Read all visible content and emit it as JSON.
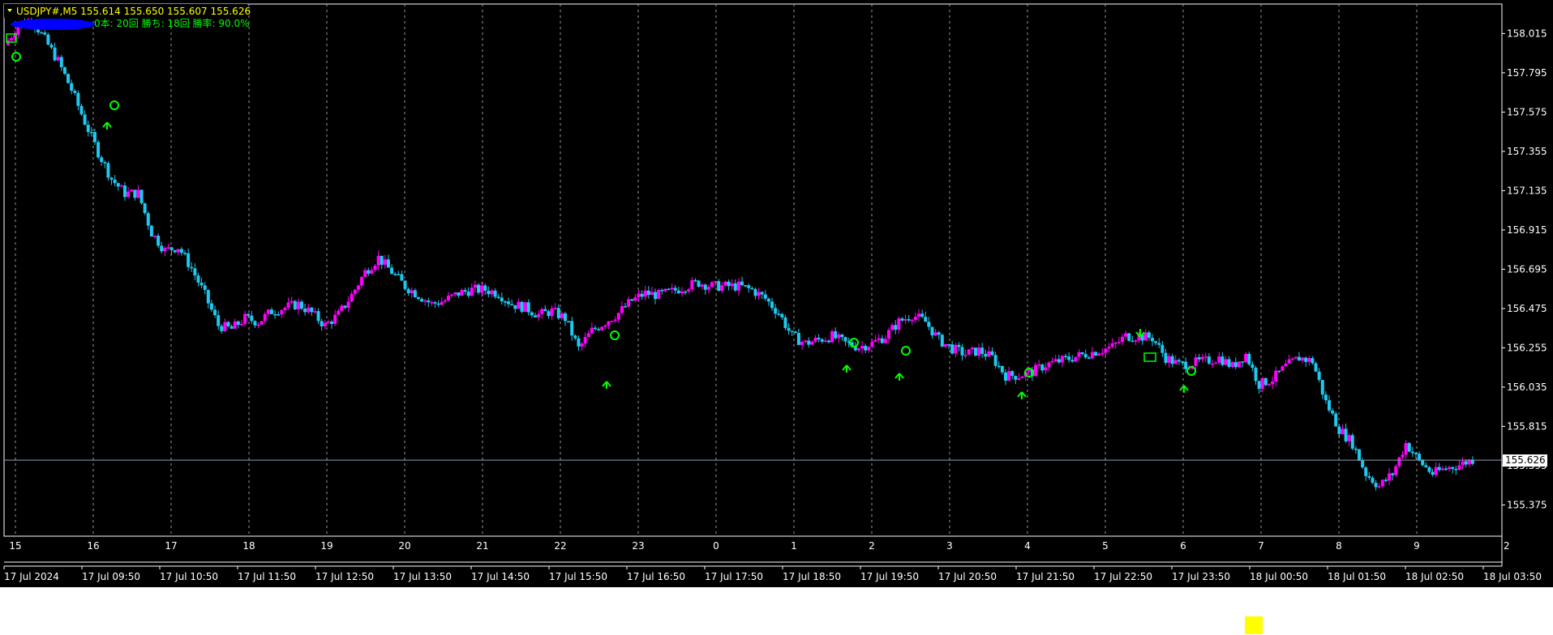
{
  "header": {
    "symbol_line": "USDJPY#,M5  155.614 155.650 155.607 155.626",
    "stats_visible": "0本: 20回    勝ち: 18回    勝率: 90.0%",
    "masked_prefix_note": ""
  },
  "colors": {
    "background": "#000000",
    "frame": "#ffffff",
    "grid": "#9a9a9a",
    "bull": "#ff00ff",
    "bear": "#1ec8f0",
    "signal": "#00ff00",
    "text": "#ffffff",
    "header_text": "#ffff00",
    "highlight": "#ffff00",
    "scribble": "#0000ff"
  },
  "chart_data": {
    "type": "candlestick",
    "symbol": "USDJPY#",
    "timeframe": "M5",
    "ohlc_current": {
      "open": 155.614,
      "high": 155.65,
      "low": 155.607,
      "close": 155.626
    },
    "current_price": "155.626",
    "ylim": [
      155.2,
      158.18
    ],
    "y_ticks": [
      "158.015",
      "157.795",
      "157.575",
      "157.355",
      "157.135",
      "156.915",
      "156.695",
      "156.475",
      "156.255",
      "156.035",
      "155.815",
      "155.595",
      "155.375"
    ],
    "hour_labels": [
      "15",
      "16",
      "17",
      "18",
      "19",
      "20",
      "21",
      "22",
      "23",
      "0",
      "1",
      "2",
      "3",
      "4",
      "5",
      "6",
      "7",
      "8",
      "9",
      "2"
    ],
    "x_labels": [
      "17 Jul 2024",
      "17 Jul 09:50",
      "17 Jul 10:50",
      "17 Jul 11:50",
      "17 Jul 12:50",
      "17 Jul 13:50",
      "17 Jul 14:50",
      "17 Jul 15:50",
      "17 Jul 16:50",
      "17 Jul 17:50",
      "17 Jul 18:50",
      "17 Jul 19:50",
      "17 Jul 20:50",
      "17 Jul 21:50",
      "17 Jul 22:50",
      "17 Jul 23:50",
      "18 Jul 00:50",
      "18 Jul 01:50",
      "18 Jul 02:50",
      "18 Jul 03:50"
    ],
    "close_path": [
      [
        0,
        157.95
      ],
      [
        4,
        158.06
      ],
      [
        8,
        158.1
      ],
      [
        12,
        157.98
      ],
      [
        16,
        157.86
      ],
      [
        20,
        157.7
      ],
      [
        24,
        157.52
      ],
      [
        28,
        157.35
      ],
      [
        32,
        157.2
      ],
      [
        36,
        157.12
      ],
      [
        40,
        157.12
      ],
      [
        44,
        156.9
      ],
      [
        48,
        156.8
      ],
      [
        52,
        156.82
      ],
      [
        56,
        156.7
      ],
      [
        60,
        156.55
      ],
      [
        64,
        156.38
      ],
      [
        68,
        156.36
      ],
      [
        72,
        156.42
      ],
      [
        76,
        156.4
      ],
      [
        80,
        156.46
      ],
      [
        84,
        156.48
      ],
      [
        88,
        156.5
      ],
      [
        92,
        156.45
      ],
      [
        96,
        156.38
      ],
      [
        100,
        156.44
      ],
      [
        104,
        156.55
      ],
      [
        108,
        156.68
      ],
      [
        112,
        156.76
      ],
      [
        116,
        156.68
      ],
      [
        120,
        156.6
      ],
      [
        124,
        156.55
      ],
      [
        128,
        156.5
      ],
      [
        132,
        156.52
      ],
      [
        136,
        156.56
      ],
      [
        140,
        156.58
      ],
      [
        144,
        156.58
      ],
      [
        148,
        156.56
      ],
      [
        152,
        156.5
      ],
      [
        156,
        156.48
      ],
      [
        160,
        156.44
      ],
      [
        164,
        156.46
      ],
      [
        168,
        156.42
      ],
      [
        172,
        156.25
      ],
      [
        176,
        156.35
      ],
      [
        180,
        156.4
      ],
      [
        184,
        156.45
      ],
      [
        188,
        156.52
      ],
      [
        192,
        156.56
      ],
      [
        196,
        156.55
      ],
      [
        200,
        156.57
      ],
      [
        204,
        156.6
      ],
      [
        208,
        156.62
      ],
      [
        212,
        156.6
      ],
      [
        216,
        156.6
      ],
      [
        220,
        156.6
      ],
      [
        224,
        156.58
      ],
      [
        228,
        156.53
      ],
      [
        232,
        156.45
      ],
      [
        236,
        156.32
      ],
      [
        240,
        156.28
      ],
      [
        244,
        156.3
      ],
      [
        248,
        156.32
      ],
      [
        252,
        156.28
      ],
      [
        256,
        156.26
      ],
      [
        260,
        156.28
      ],
      [
        264,
        156.32
      ],
      [
        268,
        156.4
      ],
      [
        272,
        156.44
      ],
      [
        276,
        156.4
      ],
      [
        280,
        156.3
      ],
      [
        284,
        156.25
      ],
      [
        288,
        156.22
      ],
      [
        292,
        156.24
      ],
      [
        296,
        156.2
      ],
      [
        300,
        156.1
      ],
      [
        304,
        156.1
      ],
      [
        308,
        156.12
      ],
      [
        312,
        156.16
      ],
      [
        316,
        156.18
      ],
      [
        320,
        156.2
      ],
      [
        324,
        156.22
      ],
      [
        328,
        156.24
      ],
      [
        332,
        156.26
      ],
      [
        336,
        156.32
      ],
      [
        340,
        156.32
      ],
      [
        344,
        156.31
      ],
      [
        348,
        156.2
      ],
      [
        352,
        156.16
      ],
      [
        356,
        156.17
      ],
      [
        360,
        156.18
      ],
      [
        364,
        156.2
      ],
      [
        368,
        156.15
      ],
      [
        372,
        156.22
      ],
      [
        376,
        156.05
      ],
      [
        380,
        156.08
      ],
      [
        384,
        156.15
      ],
      [
        388,
        156.2
      ],
      [
        392,
        156.18
      ],
      [
        396,
        155.95
      ],
      [
        400,
        155.8
      ],
      [
        404,
        155.72
      ],
      [
        408,
        155.55
      ],
      [
        412,
        155.48
      ],
      [
        416,
        155.55
      ],
      [
        420,
        155.72
      ],
      [
        424,
        155.62
      ],
      [
        428,
        155.55
      ],
      [
        432,
        155.58
      ],
      [
        436,
        155.6
      ],
      [
        440,
        155.63
      ]
    ]
  }
}
